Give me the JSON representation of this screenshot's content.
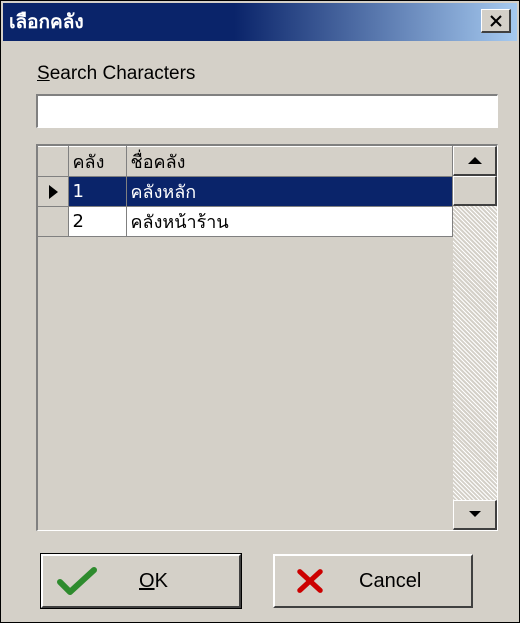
{
  "dialog": {
    "title": "เลือกคลัง",
    "close_label": "×"
  },
  "search": {
    "label_rest": "earch Characters",
    "label_accel": "S",
    "value": "",
    "placeholder": ""
  },
  "grid": {
    "columns": [
      "คลัง",
      "ชื่อคลัง"
    ],
    "rows": [
      {
        "code": "1",
        "name": "คลังหลัก",
        "selected": true
      },
      {
        "code": "2",
        "name": "คลังหน้าร้าน",
        "selected": false
      }
    ]
  },
  "buttons": {
    "ok": {
      "accel": "O",
      "rest": "K",
      "icon": "checkmark-icon",
      "color": "#2e8b2e"
    },
    "cancel": {
      "label": "Cancel",
      "icon": "x-icon",
      "color": "#cc0000"
    }
  },
  "colors": {
    "titlebar": "#0a246a",
    "selection": "#0a246a",
    "face": "#d4d0c8"
  }
}
